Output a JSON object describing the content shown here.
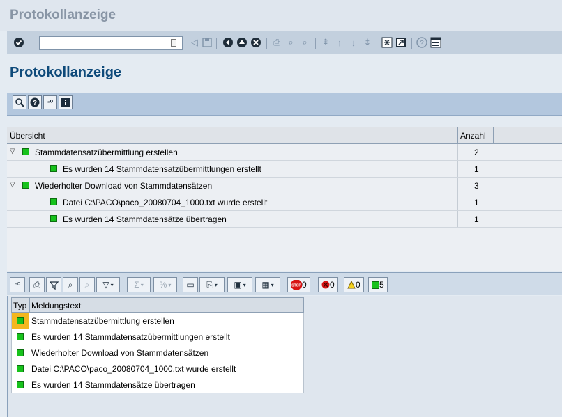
{
  "window": {
    "title": "Protokollanzeige"
  },
  "toolbar": {
    "command_value": ""
  },
  "page": {
    "heading": "Protokollanzeige"
  },
  "tree": {
    "col_overview": "Übersicht",
    "col_count": "Anzahl",
    "rows": [
      {
        "label": "Stammdatensatzübermittlung erstellen",
        "count": "2"
      },
      {
        "label": "Es wurden 14 Stammdatensatzübermittlungen erstellt",
        "count": "1"
      },
      {
        "label": "Wiederholter Download von Stammdatensätzen",
        "count": "3"
      },
      {
        "label": "Datei C:\\PACO\\paco_20080704_1000.txt wurde erstellt",
        "count": "1"
      },
      {
        "label": "Es wurden 14 Stammdatensätze übertragen",
        "count": "1"
      }
    ]
  },
  "alv": {
    "stop_count": "0",
    "error_count": "0",
    "warning_count": "0",
    "success_count": "5"
  },
  "grid": {
    "col_type": "Typ",
    "col_text": "Meldungstext",
    "rows": [
      {
        "text": "Stammdatensatzübermittlung erstellen"
      },
      {
        "text": "Es wurden 14 Stammdatensatzübermittlungen erstellt"
      },
      {
        "text": "Wiederholter Download von Stammdatensätzen"
      },
      {
        "text": "Datei C:\\PACO\\paco_20080704_1000.txt wurde erstellt"
      },
      {
        "text": "Es wurden 14 Stammdatensätze übertragen"
      }
    ]
  },
  "colors": {
    "success": "#17c21c",
    "selected": "#f4b71e",
    "heading": "#0e4a7a"
  }
}
